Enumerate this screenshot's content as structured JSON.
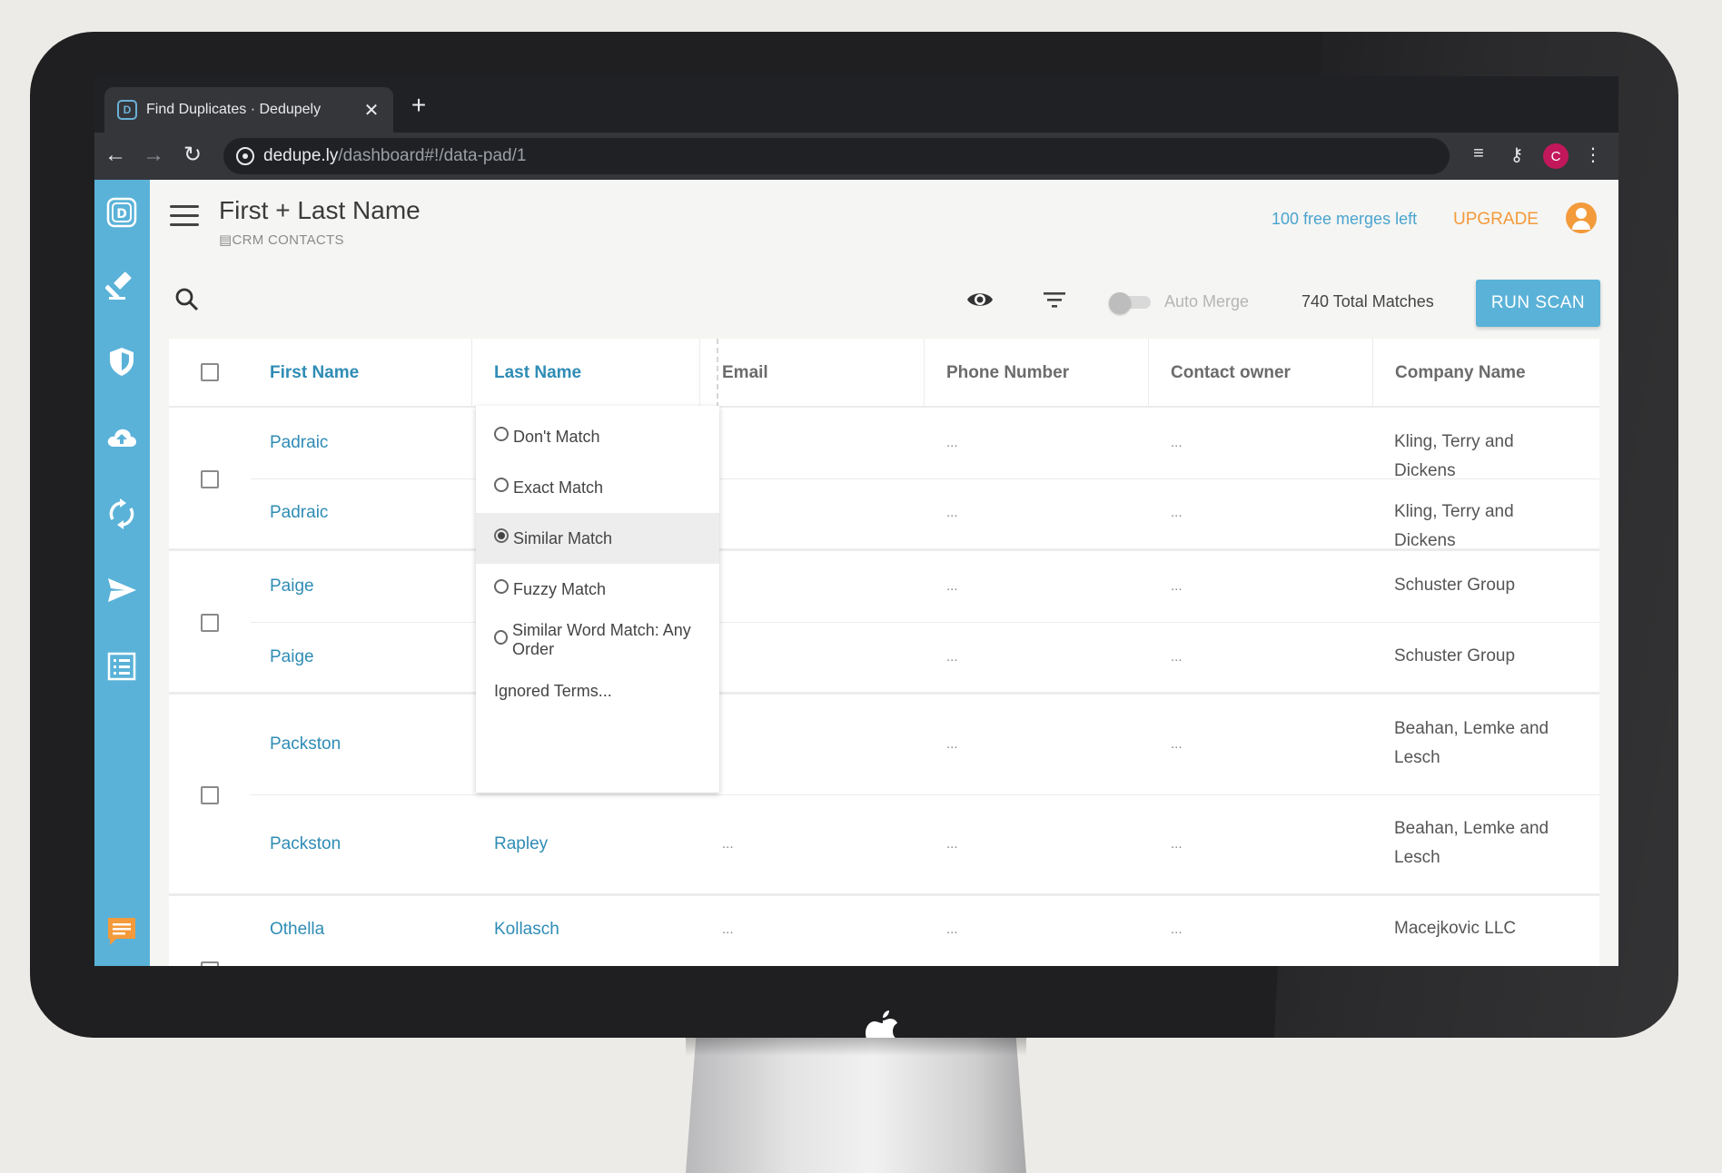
{
  "browser": {
    "tab_title": "Find Duplicates · Dedupely",
    "tab_favicon": "D",
    "url_host": "dedupe.ly",
    "url_path": "/dashboard#!/data-pad/1",
    "profile_initial": "C"
  },
  "header": {
    "title": "First + Last Name",
    "subtitle": "CRM CONTACTS",
    "merges_left": "100 free merges left",
    "upgrade": "UPGRADE"
  },
  "toolbar": {
    "auto_merge_label": "Auto Merge",
    "total_matches": "740 Total Matches",
    "run_scan": "RUN SCAN"
  },
  "sidebar": {
    "items": [
      "logo-icon",
      "gavel-icon",
      "shield-icon",
      "cloud-upload-icon",
      "sync-icon",
      "send-icon",
      "list-icon",
      "chat-icon"
    ]
  },
  "table": {
    "columns": [
      "First Name",
      "Last Name",
      "Email",
      "Phone Number",
      "Contact owner",
      "Company Name"
    ],
    "rows": [
      {
        "first": "Padraic",
        "last": "",
        "email": "",
        "phone": "...",
        "owner": "...",
        "company": "Kling, Terry and Dickens"
      },
      {
        "first": "Padraic",
        "last": "",
        "email": "",
        "phone": "...",
        "owner": "...",
        "company": "Kling, Terry and Dickens"
      },
      {
        "first": "Paige",
        "last": "",
        "email": "",
        "phone": "...",
        "owner": "...",
        "company": "Schuster Group"
      },
      {
        "first": "Paige",
        "last": "",
        "email": "",
        "phone": "...",
        "owner": "...",
        "company": "Schuster Group"
      },
      {
        "first": "Packston",
        "last": "",
        "email": "",
        "phone": "...",
        "owner": "...",
        "company": "Beahan, Lemke and Lesch"
      },
      {
        "first": "Packston",
        "last": "Rapley",
        "email": "...",
        "phone": "...",
        "owner": "...",
        "company": "Beahan, Lemke and Lesch"
      },
      {
        "first": "Othella",
        "last": "Kollasch",
        "email": "...",
        "phone": "...",
        "owner": "...",
        "company": "Macejkovic LLC"
      }
    ]
  },
  "match_menu": {
    "options": [
      "Don't Match",
      "Exact Match",
      "Similar Match",
      "Fuzzy Match",
      "Similar Word Match: Any Order"
    ],
    "selected": "Similar Match",
    "ignored_terms": "Ignored Terms..."
  },
  "colors": {
    "accent": "#5ab2d8",
    "link": "#2f8cb5",
    "upgrade": "#f39a3b"
  }
}
